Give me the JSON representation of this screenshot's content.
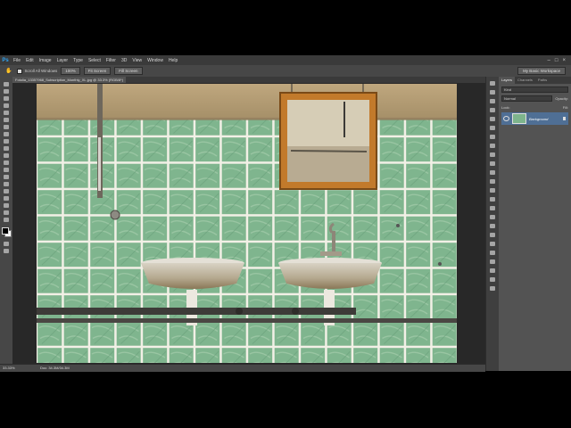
{
  "app": {
    "logo": "Ps"
  },
  "menu": [
    "File",
    "Edit",
    "Image",
    "Layer",
    "Type",
    "Select",
    "Filter",
    "3D",
    "View",
    "Window",
    "Help"
  ],
  "window_controls": {
    "minimize": "–",
    "maximize": "□",
    "close": "×"
  },
  "options": {
    "tool_icon": "hand-icon",
    "scroll_all_windows": "Scroll All Windows",
    "zoom_100": "100%",
    "fit_screen": "Fit Screen",
    "fill_screen": "Fill Screen",
    "workspace": "My Basic Workspace"
  },
  "document": {
    "tab_title": "Fotolia_13357968_Subscription_Monthly_XL.jpg @ 33.3% (RGB/8*)"
  },
  "status": {
    "zoom": "33.33%",
    "doc_size": "Doc: 34.3M/34.3M"
  },
  "layers_panel": {
    "tabs": [
      "Layers",
      "Channels",
      "Paths"
    ],
    "filter_kind": "Kind",
    "blend_mode": "Normal",
    "opacity_label": "Opacity:",
    "lock_label": "Lock:",
    "fill_label": "Fill:",
    "layer_name": "Background"
  },
  "colors": {
    "app_bg": "#535353",
    "menubar": "#3a3a3a",
    "tile": "#7fb58e",
    "frame": "#c27a2b",
    "selection": "#4f6f95"
  }
}
